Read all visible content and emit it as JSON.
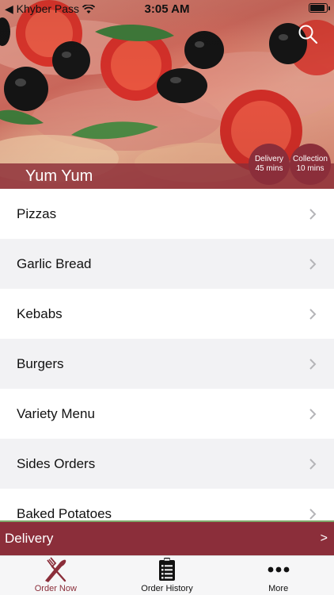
{
  "status_bar": {
    "carrier": "◀ Khyber Pass",
    "time": "3:05 AM"
  },
  "store": {
    "name": "Yum Yum"
  },
  "badges": {
    "delivery": {
      "title": "Delivery",
      "value": "45 mins"
    },
    "collection": {
      "title": "Collection",
      "value": "10 mins"
    }
  },
  "categories": [
    {
      "label": "Pizzas"
    },
    {
      "label": "Garlic Bread"
    },
    {
      "label": "Kebabs"
    },
    {
      "label": "Burgers"
    },
    {
      "label": "Variety Menu"
    },
    {
      "label": "Sides Orders"
    },
    {
      "label": "Baked Potatoes"
    }
  ],
  "delivery_bar": {
    "label": "Delivery",
    "arrow": ">"
  },
  "tabs": [
    {
      "label": "Order Now",
      "icon": "fork-knife-icon",
      "active": true
    },
    {
      "label": "Order History",
      "icon": "clipboard-list-icon",
      "active": false
    },
    {
      "label": "More",
      "icon": "more-dots-icon",
      "active": false
    }
  ],
  "colors": {
    "brand": "#8b2e3a",
    "row_alt": "#f2f2f4",
    "tabbar": "#f6f6f7"
  }
}
